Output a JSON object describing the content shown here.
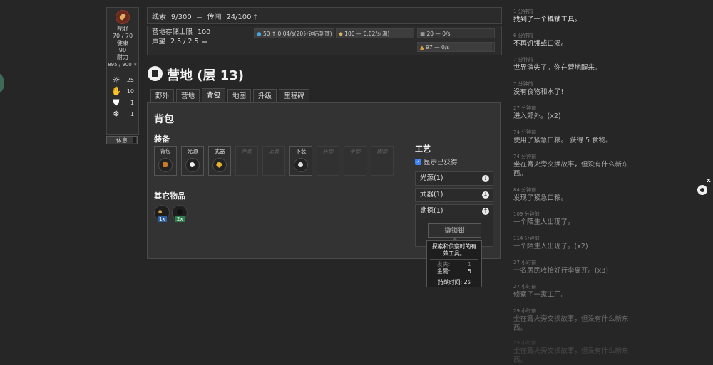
{
  "stats": {
    "vision_label": "视野",
    "vision_value": "70 / 70",
    "health_label": "健康",
    "health_value": "90",
    "stamina_label": "耐力",
    "stamina_value": "895 / 900",
    "attrs": [
      {
        "icon": "sun-icon",
        "value": "25"
      },
      {
        "icon": "hand-icon",
        "value": "10"
      },
      {
        "icon": "shield-icon",
        "value": "1"
      },
      {
        "icon": "snowflake-icon",
        "value": "1"
      }
    ],
    "rest_label": "休息"
  },
  "topbar": {
    "clues_label": "线索",
    "clues_value": "9/300",
    "rumors_label": "传闻",
    "rumors_value": "24/100"
  },
  "storage": {
    "limit_label": "营地存储上限",
    "limit_value": "100",
    "reputation_label": "声望",
    "reputation_value": "2.5 / 2.5",
    "chips": [
      {
        "text": "50 ↑ 0.04/s(20分钟后到顶)",
        "fill": 0.5
      },
      {
        "text": "100 — 0.02/s(满)",
        "fill": 1.0
      },
      {
        "text": "20 — 0/s",
        "fill": 0.2
      },
      {
        "text": "97 — 0/s",
        "fill": 0.97
      }
    ]
  },
  "camp": {
    "title": "营地 (层 13)"
  },
  "tabs": [
    "野外",
    "营地",
    "背包",
    "地图",
    "升级",
    "里程碑"
  ],
  "bag": {
    "title": "背包",
    "equipment_title": "装备",
    "slots": [
      "背包",
      "光源",
      "武器",
      "外套",
      "上装",
      "下装",
      "头部",
      "手部",
      "脚部"
    ],
    "other_title": "其它物品",
    "items": [
      {
        "qty": "1x"
      },
      {
        "qty": "2x"
      }
    ]
  },
  "craft": {
    "title": "工艺",
    "show_obtained": "显示已获得",
    "categories": [
      "光源(1)",
      "武器(1)",
      "勘探(1)"
    ],
    "item_button": "撬锁钳",
    "tooltip": {
      "desc": "探索和侦察时的有效工具。",
      "hair_label": "发夹:",
      "hair_value": "1",
      "metal_label": "金属:",
      "metal_value": "5",
      "duration": "持续时间: 2s"
    }
  },
  "log": [
    {
      "time": "1 分钟前",
      "msg": "找到了一个撬锁工具。"
    },
    {
      "time": "6 分钟前",
      "msg": "不再饥饿或口渴。"
    },
    {
      "time": "7 分钟前",
      "msg": "世界消失了。你在营地醒来。"
    },
    {
      "time": "7 分钟前",
      "msg": "没有食物和水了!"
    },
    {
      "time": "27 分钟前",
      "msg": "进入郊外。(x2)"
    },
    {
      "time": "74 分钟前",
      "msg": "使用了紧急口粮。 获得 5 食物。"
    },
    {
      "time": "74 分钟前",
      "msg": "坐在篝火旁交换故事，但没有什么新东西。"
    },
    {
      "time": "84 分钟前",
      "msg": "发现了紧急口粮。"
    },
    {
      "time": "109 分钟前",
      "msg": "一个陌生人出现了。"
    },
    {
      "time": "114 分钟前",
      "msg": "一个陌生人出现了。(x2)"
    },
    {
      "time": "27 小时前",
      "msg": "一名居民收拾好行李离开。(x3)"
    },
    {
      "time": "27 小时前",
      "msg": "侦察了一家工厂。"
    },
    {
      "time": "29 小时前",
      "msg": "坐在篝火旁交换故事，但没有什么新东西。"
    },
    {
      "time": "29 小时前",
      "msg": "坐在篝火旁交换故事，但没有什么新东西。"
    }
  ],
  "colors": {
    "bg": "#262626",
    "panel": "#333333",
    "accent_blue": "#2f5f9e",
    "accent_green": "#2e7d4f"
  }
}
